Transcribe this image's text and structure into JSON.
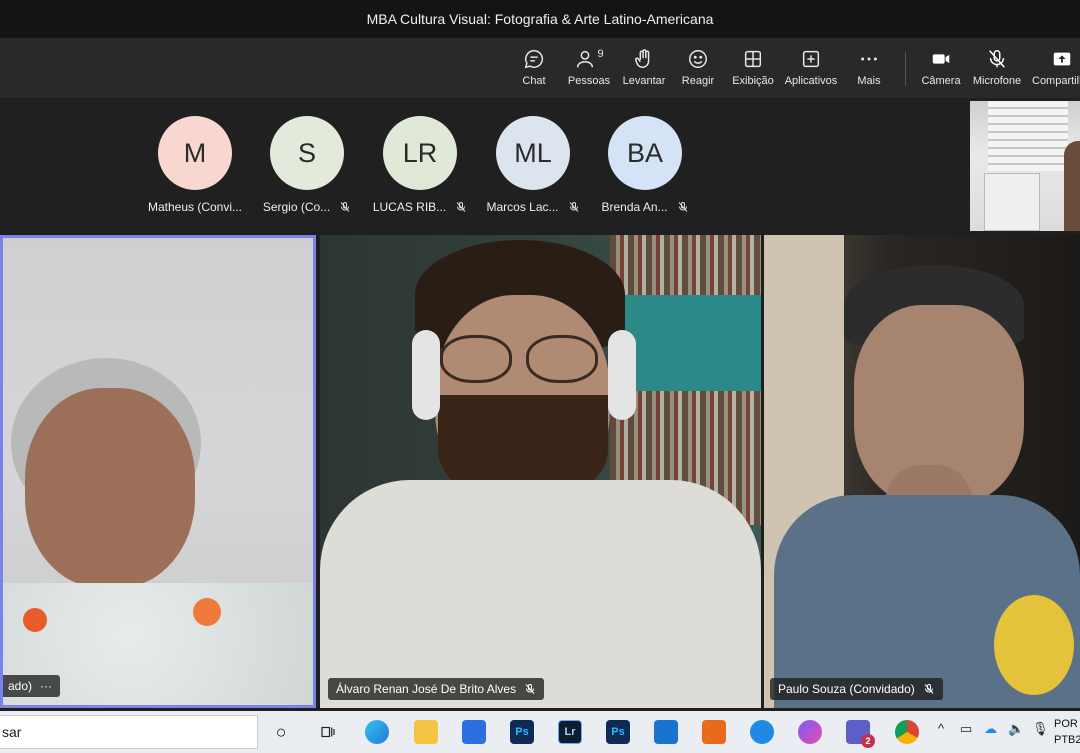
{
  "window": {
    "title": "MBA Cultura Visual: Fotografia & Arte Latino-Americana"
  },
  "toolbar": {
    "chat": "Chat",
    "people": "Pessoas",
    "people_count": "9",
    "raise": "Levantar",
    "react": "Reagir",
    "view": "Exibição",
    "apps": "Aplicativos",
    "more": "Mais",
    "camera": "Câmera",
    "mic": "Microfone",
    "share": "Compartilh"
  },
  "participants": [
    {
      "initials": "M",
      "name": "Matheus (Convi...",
      "color": "#f8d7d0",
      "muted": false
    },
    {
      "initials": "S",
      "name": "Sergio (Co...",
      "color": "#e3eadb",
      "muted": true
    },
    {
      "initials": "LR",
      "name": "LUCAS RIB...",
      "color": "#e0e9d8",
      "muted": true
    },
    {
      "initials": "ML",
      "name": "Marcos Lac...",
      "color": "#dce4ee",
      "muted": true
    },
    {
      "initials": "BA",
      "name": "Brenda An...",
      "color": "#d4e3f6",
      "muted": true
    }
  ],
  "tiles": {
    "left_label": "ado)",
    "left_more": "···",
    "center_label": "Álvaro Renan José De Brito Alves",
    "right_label": "Paulo Souza (Convidado)"
  },
  "taskbar": {
    "search_text": "sar",
    "lang_line1": "POR",
    "lang_line2": "PTB2",
    "teams_badge": "2"
  },
  "colors": {
    "active_speaker_border": "#7b83eb",
    "titlebar": "#141414",
    "toolbar": "#292929"
  }
}
